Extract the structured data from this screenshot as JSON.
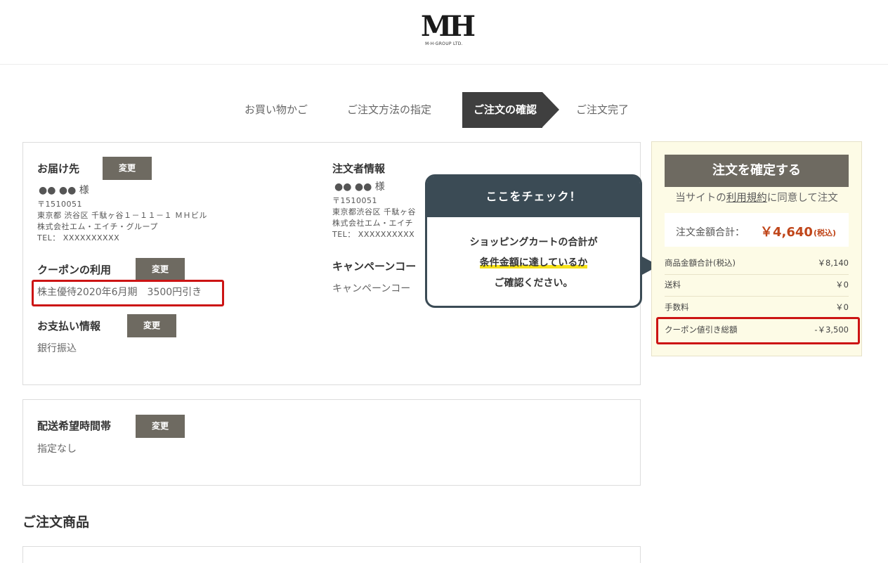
{
  "header": {
    "logo_mark": "MH",
    "logo_sub": "M·H·GROUP LTD."
  },
  "steps": [
    "お買い物かご",
    "ご注文方法の指定",
    "ご注文の確認",
    "ご注文完了"
  ],
  "delivery": {
    "title": "お届け先",
    "change_label": "変更",
    "name": "●● ●● 様",
    "postal": "〒1510051",
    "address": "東京都 渋谷区 千駄ヶ谷１－１１－１ ＭＨビル",
    "company": "株式会社エム・エイチ・グループ",
    "tel": "TEL： XXXXXXXXXX"
  },
  "orderer": {
    "title": "注文者情報",
    "name": "●● ●● 様",
    "postal": "〒1510051",
    "address": "東京都渋谷区 千駄ヶ谷",
    "company": "株式会社エム・エイチ",
    "tel": "TEL： XXXXXXXXXX"
  },
  "coupon": {
    "title": "クーポンの利用",
    "change_label": "変更",
    "value": "株主優待2020年6月期　3500円引き"
  },
  "campaign": {
    "title": "キャンペーンコー",
    "value": "キャンペーンコー"
  },
  "payment": {
    "title": "お支払い情報",
    "change_label": "変更",
    "value": "銀行振込"
  },
  "delivery_time": {
    "title": "配送希望時間帯",
    "change_label": "変更",
    "value": "指定なし"
  },
  "order_items_title": "ご注文商品",
  "callout": {
    "title": "ここをチェック！",
    "line1": "ショッピングカートの合計が",
    "line2": "条件金額に達しているか",
    "line3": "ご確認ください。"
  },
  "summary": {
    "confirm_label": "注文を確定する",
    "terms_prefix": "当サイトの",
    "terms_link": "利用規約",
    "terms_suffix": "に同意して注文",
    "total_label": "注文金額合計：",
    "total_value": "￥4,640",
    "total_tax": "(税込)",
    "rows": [
      {
        "label": "商品金額合計(税込)",
        "value": "￥8,140"
      },
      {
        "label": "送料",
        "value": "￥0"
      },
      {
        "label": "手数料",
        "value": "￥0"
      },
      {
        "label": "クーポン値引き総額",
        "value": "-￥3,500"
      }
    ]
  },
  "colors": {
    "button": "#6e6a61",
    "active_step": "#3f3f3f",
    "callout": "#3b4b55",
    "highlight": "#cc1414",
    "total": "#c0461a",
    "side_bg": "#fdfbe6"
  }
}
